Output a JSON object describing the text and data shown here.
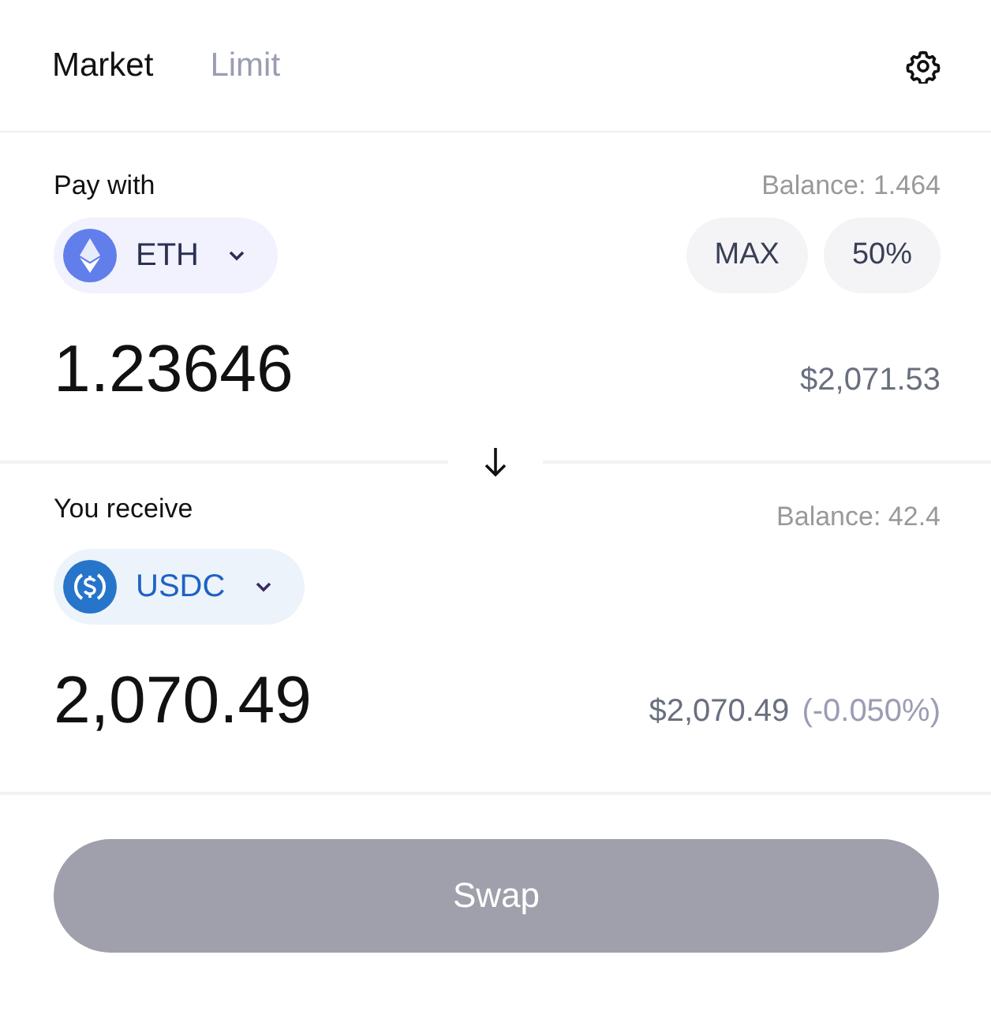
{
  "tabs": [
    {
      "label": "Market",
      "selected": true
    },
    {
      "label": "Limit",
      "selected": false
    }
  ],
  "pay": {
    "label": "Pay with",
    "balance": "Balance: 1.464",
    "token": {
      "kind": "eth",
      "symbol": "ETH"
    },
    "quick_buttons": [
      "MAX",
      "50%"
    ],
    "amount": "1.23646",
    "usd_value": "$2,071.53"
  },
  "receive": {
    "label": "You receive",
    "balance": "Balance: 42.4",
    "token": {
      "kind": "usdc",
      "symbol": "USDC"
    },
    "amount": "2,070.49",
    "usd_value": "$2,070.49",
    "price_impact": "(-0.050%)"
  },
  "swap_button": {
    "label": "Swap",
    "disabled": true
  }
}
